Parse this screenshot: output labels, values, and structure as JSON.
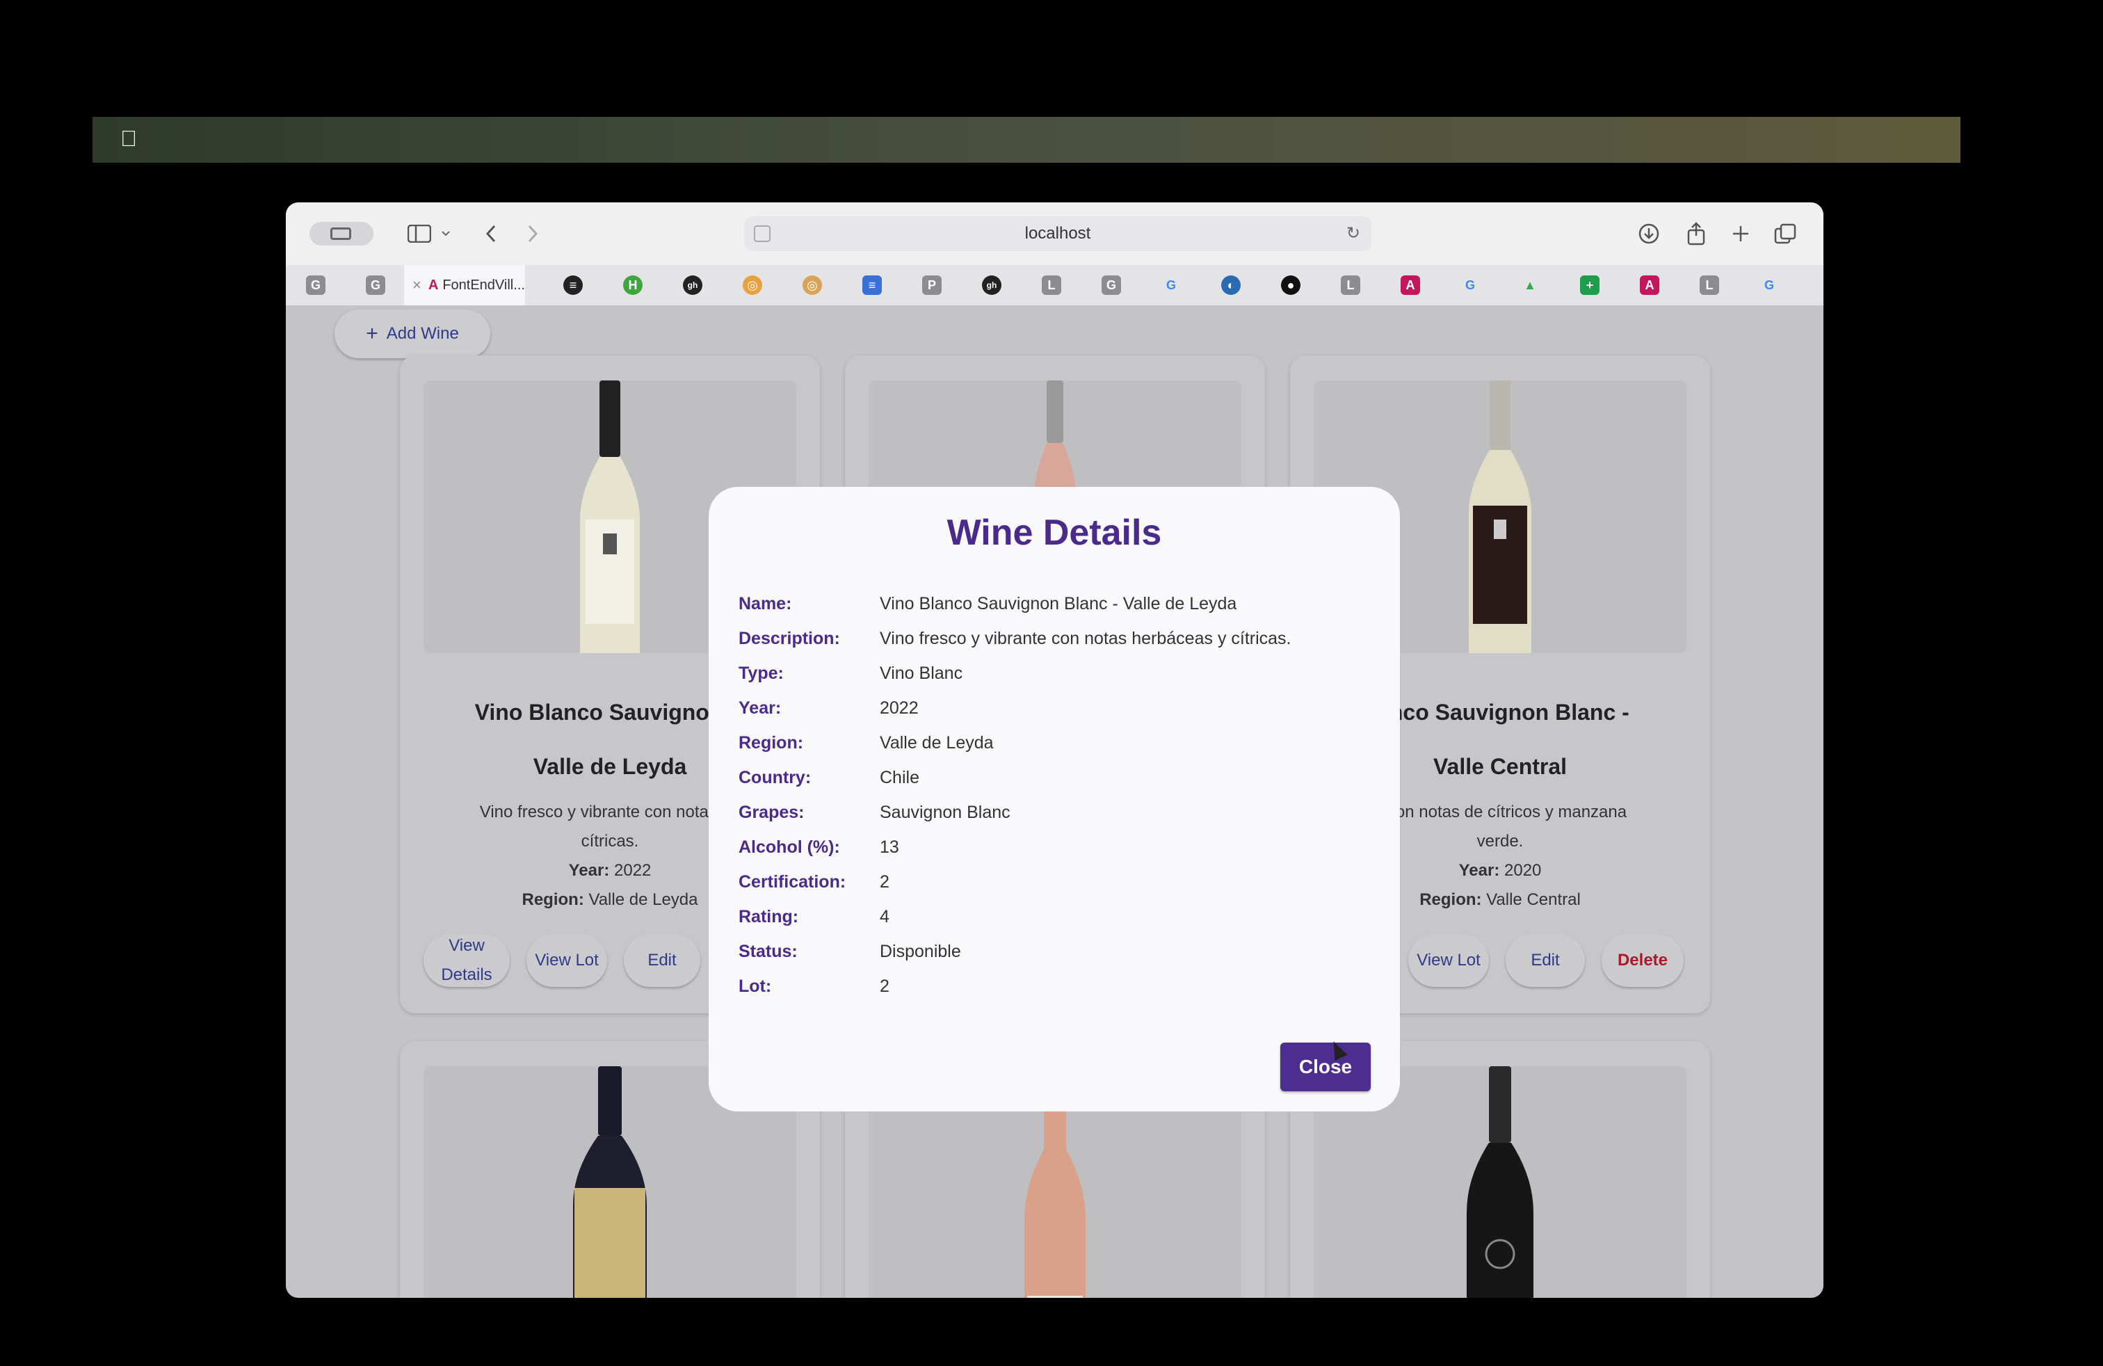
{
  "browser": {
    "url": "localhost",
    "active_tab_title": "FontEndVill...",
    "tab_icons": [
      "G",
      "G",
      "",
      "≡",
      "H",
      "gh",
      "◎",
      "◎",
      "≡",
      "P",
      "gh",
      "L",
      "G",
      "G",
      "◐",
      "●",
      "L",
      "A",
      "G",
      "▲",
      "+",
      "A",
      "L",
      "G"
    ]
  },
  "page": {
    "add_wine_label": "Add Wine"
  },
  "cards": [
    {
      "title_line1": "Vino Blanco Sauvignon B",
      "title_line2": "Valle de Leyda",
      "desc_line1": "Vino fresco y vibrante con notas he",
      "desc_line2": "cítricas.",
      "year_label": "Year:",
      "year": "2022",
      "region_label": "Region:",
      "region": "Valle de Leyda",
      "buttons": [
        "View Details",
        "View Lot",
        "Edit"
      ]
    },
    {
      "title_line1": "lanco Sauvignon Blanc -",
      "title_line2": "Valle Central",
      "desc_line1": "o con notas de cítricos y manzana",
      "desc_line2": "verde.",
      "year_label": "Year:",
      "year": "2020",
      "region_label": "Region:",
      "region": "Valle Central",
      "buttons": [
        "View Lot",
        "Edit",
        "Delete"
      ]
    }
  ],
  "modal": {
    "title": "Wine Details",
    "rows": [
      {
        "label": "Name:",
        "value": "Vino Blanco Sauvignon Blanc - Valle de Leyda"
      },
      {
        "label": "Description:",
        "value": "Vino fresco y vibrante con notas herbáceas y cítricas."
      },
      {
        "label": "Type:",
        "value": "Vino Blanc"
      },
      {
        "label": "Year:",
        "value": "2022"
      },
      {
        "label": "Region:",
        "value": "Valle de Leyda"
      },
      {
        "label": "Country:",
        "value": "Chile"
      },
      {
        "label": "Grapes:",
        "value": "Sauvignon Blanc"
      },
      {
        "label": "Alcohol (%):",
        "value": "13"
      },
      {
        "label": "Certification:",
        "value": "2"
      },
      {
        "label": "Rating:",
        "value": "4"
      },
      {
        "label": "Status:",
        "value": "Disponible"
      },
      {
        "label": "Lot:",
        "value": "2"
      }
    ],
    "close_label": "Close"
  },
  "colors": {
    "accent": "#4a2a8a",
    "close_button": "#4d2d90",
    "link_text": "#2f3a8a",
    "delete_text": "#b0182a"
  }
}
